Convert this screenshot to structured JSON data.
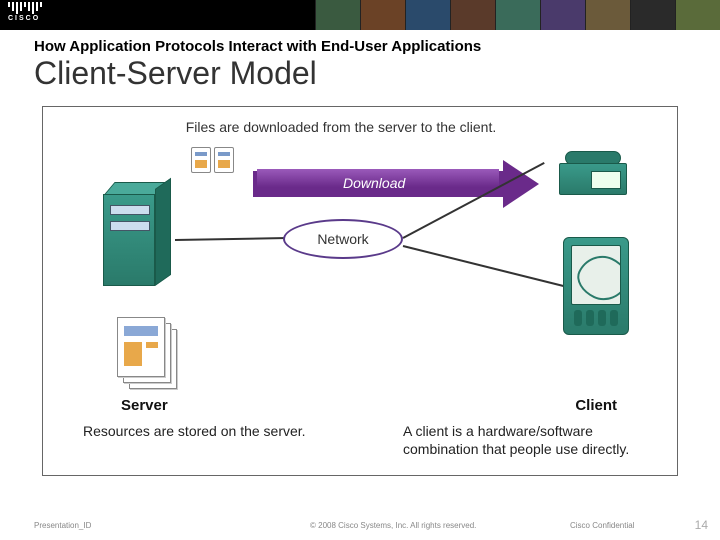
{
  "header": {
    "brand": "cisco",
    "subheading": "How Application Protocols Interact with End-User Applications",
    "title": "Client-Server Model"
  },
  "diagram": {
    "banner_top": "Files are downloaded from the server to the client.",
    "download_label": "Download",
    "network_label": "Network",
    "server_label": "Server",
    "client_label": "Client",
    "server_caption": "Resources are stored on the server.",
    "client_caption": "A client is a hardware/software combination that people use directly."
  },
  "footer": {
    "presentation_id": "Presentation_ID",
    "copyright": "© 2008 Cisco Systems, Inc. All rights reserved.",
    "confidential": "Cisco Confidential",
    "page_number": "14"
  }
}
